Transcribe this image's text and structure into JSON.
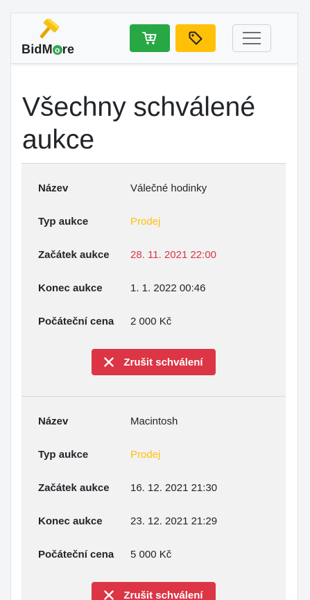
{
  "brand": {
    "name_prefix": "BidM",
    "name_o": "o",
    "name_suffix": "re"
  },
  "nav": {
    "cart_icon": "cart-icon",
    "tag_icon": "tag-icon",
    "menu_icon": "hamburger-icon"
  },
  "page": {
    "title": "Všechny schválené aukce"
  },
  "colors": {
    "auction_type": "#ffc107",
    "start_date": "#dc3545",
    "cancel_button": "#dc3545",
    "cart_button": "#28a745",
    "tag_button": "#ffc107"
  },
  "auctions": [
    {
      "name_label": "Název",
      "name": "Válečné hodinky",
      "type_label": "Typ aukce",
      "type": "Prodej",
      "start_label": "Začátek aukce",
      "start": "28. 11. 2021 22:00",
      "end_label": "Konec aukce",
      "end": "1. 1. 2022 00:46",
      "price_label": "Počáteční cena",
      "price": "2 000 Kč",
      "cancel_label": "Zrušit schválení"
    },
    {
      "name_label": "Název",
      "name": "Macintosh",
      "type_label": "Typ aukce",
      "type": "Prodej",
      "start_label": "Začátek aukce",
      "start": "16. 12. 2021 21:30",
      "end_label": "Konec aukce",
      "end": "23. 12. 2021 21:29",
      "price_label": "Počáteční cena",
      "price": "5 000 Kč",
      "cancel_label": "Zrušit schválení"
    }
  ]
}
